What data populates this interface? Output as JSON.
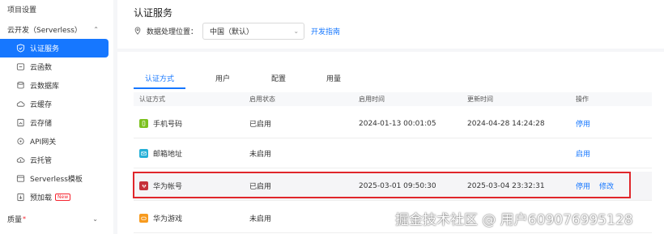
{
  "sidebar": {
    "section_title": "项目设置",
    "group_label": "云开发（Serverless）",
    "items": [
      {
        "label": "认证服务",
        "icon": "shield-check-icon",
        "active": true
      },
      {
        "label": "云函数",
        "icon": "cloud-function-icon"
      },
      {
        "label": "云数据库",
        "icon": "cloud-database-icon"
      },
      {
        "label": "云缓存",
        "icon": "cloud-cache-icon"
      },
      {
        "label": "云存储",
        "icon": "cloud-storage-icon"
      },
      {
        "label": "API网关",
        "icon": "api-gateway-icon"
      },
      {
        "label": "云托管",
        "icon": "cloud-hosting-icon"
      },
      {
        "label": "Serverless模板",
        "icon": "template-icon"
      },
      {
        "label": "预加载",
        "icon": "preload-icon",
        "badge": "New"
      }
    ],
    "quality_label": "质量"
  },
  "header": {
    "title": "认证服务",
    "location_label": "数据处理位置：",
    "location_value": "中国（默认）",
    "dev_guide_link": "开发指南"
  },
  "tabs": [
    {
      "label": "认证方式",
      "active": true
    },
    {
      "label": "用户"
    },
    {
      "label": "配置"
    },
    {
      "label": "用量"
    }
  ],
  "table": {
    "columns": [
      "认证方式",
      "启用状态",
      "启用时间",
      "更新时间",
      "操作"
    ],
    "rows": [
      {
        "name": "手机号码",
        "icon_color": "#7cc11f",
        "status": "已启用",
        "enabled_at": "2024-01-13 00:01:05",
        "updated_at": "2024-04-28 14:24:28",
        "actions": [
          "停用"
        ]
      },
      {
        "name": "邮箱地址",
        "icon_color": "#26b0d7",
        "status": "未启用",
        "enabled_at": "",
        "updated_at": "",
        "actions": [
          "启用"
        ]
      },
      {
        "name": "华为帐号",
        "icon_color": "#c6303a",
        "status": "已启用",
        "enabled_at": "2025-03-01 09:50:30",
        "updated_at": "2025-03-04 23:32:31",
        "actions": [
          "停用",
          "修改"
        ]
      },
      {
        "name": "华为游戏",
        "icon_color": "#f79a1e",
        "status": "未启用",
        "enabled_at": "",
        "updated_at": "",
        "actions": []
      }
    ]
  },
  "watermark": "掘金技术社区 @ 用户6090769951​28",
  "colors": {
    "accent": "#1677ff",
    "highlight_border": "#e0262b"
  }
}
